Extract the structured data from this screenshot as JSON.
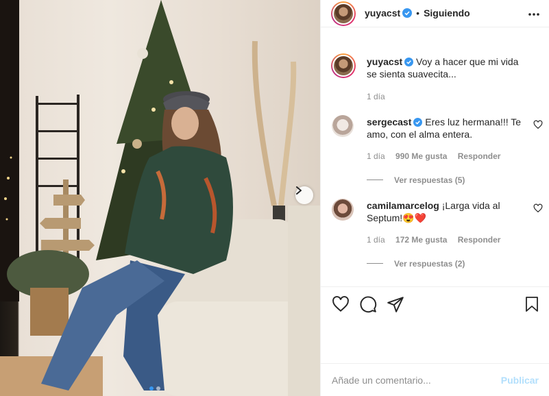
{
  "post": {
    "username": "yuyacst",
    "separator": "•",
    "follow_status": "Siguiendo",
    "more_icon": "more-horizontal-icon",
    "photo_description_icons": [
      "chevron-right-icon"
    ],
    "carousel": {
      "total": 2,
      "active_index": 0
    }
  },
  "caption": {
    "username": "yuyacst",
    "text": "Voy a hacer que mi vida se sienta suavecita...",
    "time": "1 día"
  },
  "comments": [
    {
      "username": "sergecast",
      "verified": true,
      "text": "Eres luz hermana!!! Te amo, con el alma entera.",
      "time": "1 día",
      "likes": "990 Me gusta",
      "reply": "Responder",
      "view_replies": "Ver respuestas (5)"
    },
    {
      "username": "camilamarcelog",
      "verified": false,
      "text": "¡Larga vida al Septum!😍❤️",
      "time": "1 día",
      "likes": "172 Me gusta",
      "reply": "Responder",
      "view_replies": "Ver respuestas (2)"
    }
  ],
  "actions": {
    "icons": [
      "heart-icon",
      "comment-icon",
      "share-icon",
      "bookmark-icon"
    ]
  },
  "add_comment": {
    "placeholder": "Añade un comentario...",
    "publish": "Publicar"
  },
  "colors": {
    "verified": "#3897f0",
    "muted": "#8e8e8e",
    "publish_disabled": "#b2dffc",
    "text": "#262626"
  }
}
